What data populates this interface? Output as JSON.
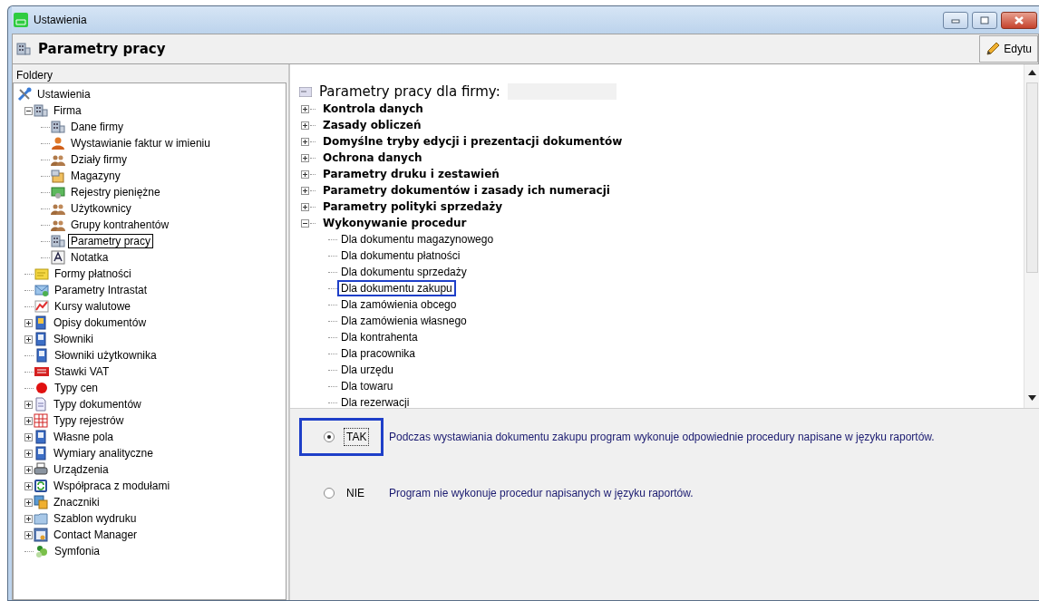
{
  "window": {
    "title": "Ustawienia"
  },
  "header": {
    "title": "Parametry pracy",
    "edit_button": "Edytu"
  },
  "folders": {
    "title": "Foldery",
    "tree": [
      {
        "label": "Ustawienia",
        "selected": false,
        "children": [
          {
            "label": "Firma",
            "selected": false,
            "expanded": true,
            "children": [
              {
                "label": "Dane firmy",
                "selected": false
              },
              {
                "label": "Wystawianie faktur w imieniu",
                "selected": false
              },
              {
                "label": "Działy firmy",
                "selected": false
              },
              {
                "label": "Magazyny",
                "selected": false
              },
              {
                "label": "Rejestry pieniężne",
                "selected": false
              },
              {
                "label": "Użytkownicy",
                "selected": false
              },
              {
                "label": "Grupy kontrahentów",
                "selected": false
              },
              {
                "label": "Parametry pracy",
                "selected": true
              },
              {
                "label": "Notatka",
                "selected": false
              }
            ]
          },
          {
            "label": "Formy płatności",
            "selected": false
          },
          {
            "label": "Parametry Intrastat",
            "selected": false
          },
          {
            "label": "Kursy walutowe",
            "selected": false
          },
          {
            "label": "Opisy dokumentów",
            "selected": false,
            "expanded": false
          },
          {
            "label": "Słowniki",
            "selected": false,
            "expanded": false
          },
          {
            "label": "Słowniki użytkownika",
            "selected": false
          },
          {
            "label": "Stawki VAT",
            "selected": false
          },
          {
            "label": "Typy cen",
            "selected": false
          },
          {
            "label": "Typy dokumentów",
            "selected": false,
            "expanded": false
          },
          {
            "label": "Typy rejestrów",
            "selected": false,
            "expanded": false
          },
          {
            "label": "Własne pola",
            "selected": false,
            "expanded": false
          },
          {
            "label": "Wymiary analityczne",
            "selected": false,
            "expanded": false
          },
          {
            "label": "Urządzenia",
            "selected": false,
            "expanded": false
          },
          {
            "label": "Współpraca z modułami",
            "selected": false,
            "expanded": false
          },
          {
            "label": "Znaczniki",
            "selected": false,
            "expanded": false
          },
          {
            "label": "Szablon wydruku",
            "selected": false,
            "expanded": false
          },
          {
            "label": "Contact Manager",
            "selected": false,
            "expanded": false
          },
          {
            "label": "Symfonia",
            "selected": false
          }
        ]
      }
    ]
  },
  "parameters": {
    "title": "Parametry pracy dla firmy:",
    "groups": [
      {
        "label": "Kontrola danych",
        "expanded": false
      },
      {
        "label": "Zasady obliczeń",
        "expanded": false
      },
      {
        "label": "Domyślne tryby edycji i prezentacji dokumentów",
        "expanded": false
      },
      {
        "label": "Ochrona danych",
        "expanded": false
      },
      {
        "label": "Parametry druku i zestawień",
        "expanded": false
      },
      {
        "label": "Parametry dokumentów i zasady ich numeracji",
        "expanded": false
      },
      {
        "label": "Parametry polityki sprzedaży",
        "expanded": false
      },
      {
        "label": "Wykonywanie procedur",
        "expanded": true,
        "children": [
          {
            "label": "Dla dokumentu magazynowego",
            "selected": false
          },
          {
            "label": "Dla dokumentu płatności",
            "selected": false
          },
          {
            "label": "Dla dokumentu sprzedaży",
            "selected": false
          },
          {
            "label": "Dla dokumentu zakupu",
            "selected": true
          },
          {
            "label": "Dla zamówienia obcego",
            "selected": false
          },
          {
            "label": "Dla zamówienia własnego",
            "selected": false
          },
          {
            "label": "Dla kontrahenta",
            "selected": false
          },
          {
            "label": "Dla pracownika",
            "selected": false
          },
          {
            "label": "Dla urzędu",
            "selected": false
          },
          {
            "label": "Dla towaru",
            "selected": false
          },
          {
            "label": "Dla rezerwacji",
            "selected": false
          }
        ]
      }
    ]
  },
  "options": [
    {
      "label": "TAK",
      "description": "Podczas wystawiania dokumentu zakupu program wykonuje odpowiednie procedury napisane w języku raportów.",
      "selected": true
    },
    {
      "label": "NIE",
      "description": "Program nie wykonuje procedur napisanych w języku raportów.",
      "selected": false
    }
  ]
}
